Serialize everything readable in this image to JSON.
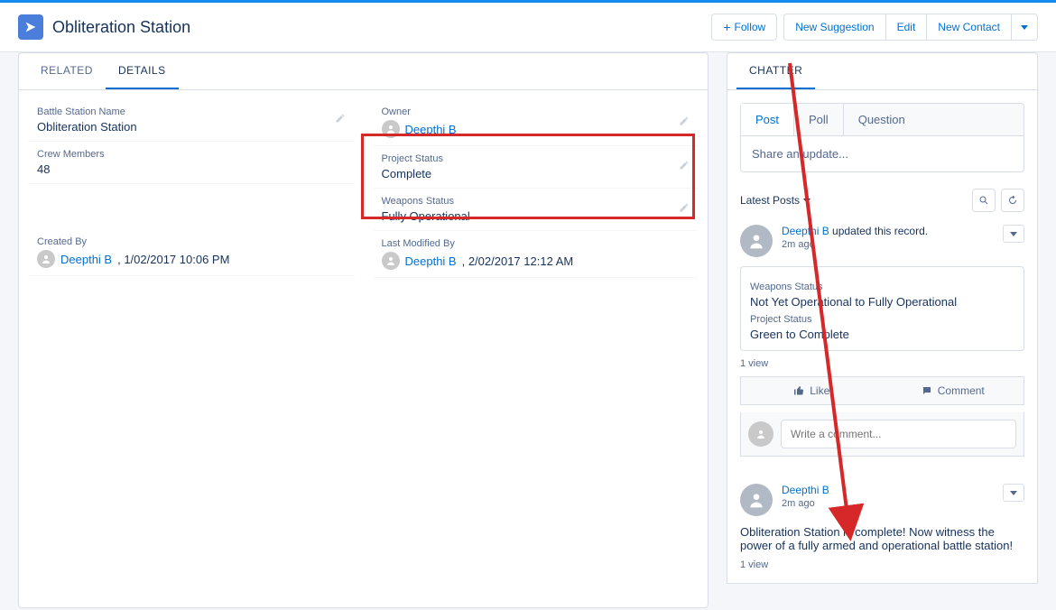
{
  "header": {
    "title": "Obliteration Station",
    "actions": {
      "follow": "Follow",
      "new_suggestion": "New Suggestion",
      "edit": "Edit",
      "new_contact": "New Contact"
    }
  },
  "tabs": {
    "related": "RELATED",
    "details": "DETAILS"
  },
  "details": {
    "battle_station_name": {
      "label": "Battle Station Name",
      "value": "Obliteration Station"
    },
    "crew_members": {
      "label": "Crew Members",
      "value": "48"
    },
    "owner": {
      "label": "Owner",
      "user": "Deepthi B"
    },
    "project_status": {
      "label": "Project Status",
      "value": "Complete"
    },
    "weapons_status": {
      "label": "Weapons Status",
      "value": "Fully Operational"
    },
    "created_by": {
      "label": "Created By",
      "user": "Deepthi B",
      "timestamp": ", 1/02/2017 10:06 PM"
    },
    "last_modified_by": {
      "label": "Last Modified By",
      "user": "Deepthi B",
      "timestamp": ", 2/02/2017 12:12 AM"
    }
  },
  "chatter": {
    "tab_label": "CHATTER",
    "publisher": {
      "post": "Post",
      "poll": "Poll",
      "question": "Question",
      "placeholder": "Share an update..."
    },
    "sort_label": "Latest Posts",
    "like_label": "Like",
    "comment_label": "Comment",
    "comment_placeholder": "Write a comment...",
    "feed": [
      {
        "user": "Deepthi B",
        "action": " updated this record.",
        "time": "2m ago",
        "changes": [
          {
            "label": "Weapons Status",
            "value": "Not Yet Operational to Fully Operational"
          },
          {
            "label": "Project Status",
            "value": "Green to Complete"
          }
        ],
        "views": "1 view"
      },
      {
        "user": "Deepthi B",
        "time": "2m ago",
        "body": "Obliteration Station is complete! Now witness the power of a fully armed and operational battle station!",
        "views": "1 view"
      }
    ]
  }
}
